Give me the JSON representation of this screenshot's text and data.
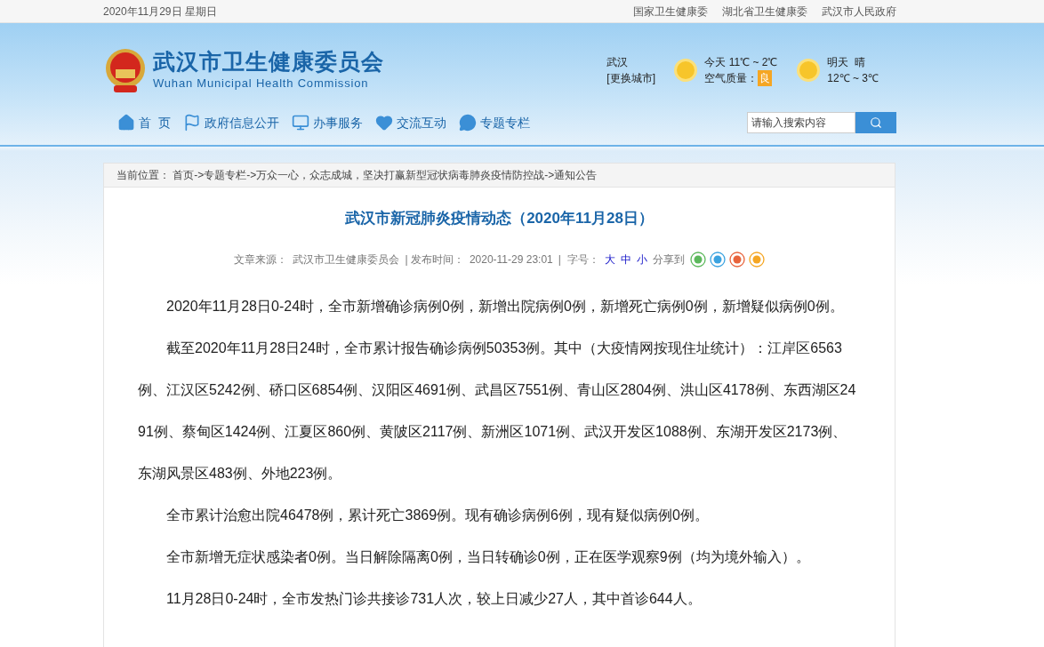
{
  "top_bar": {
    "date": "2020年11月29日 星期日",
    "links": [
      "国家卫生健康委",
      "湖北省卫生健康委",
      "武汉市人民政府"
    ]
  },
  "header": {
    "title": "武汉市卫生健康委员会",
    "subtitle": "Wuhan Municipal Health Commission",
    "weather": {
      "city": "武汉",
      "change_city": "[更换城市]",
      "today": "今天 11℃ ~ 2℃",
      "air_label": "空气质量：",
      "air_value": "良",
      "tomorrow": "明天  晴",
      "tomorrow_temp": "12℃ ~ 3℃"
    }
  },
  "nav": [
    {
      "kind": "home",
      "label": "首  页"
    },
    {
      "kind": "flag",
      "label": "政府信息公开"
    },
    {
      "kind": "monitor",
      "label": "办事服务"
    },
    {
      "kind": "heart",
      "label": "交流互动"
    },
    {
      "kind": "chat",
      "label": "专题专栏"
    }
  ],
  "search": {
    "placeholder": "请输入搜索内容"
  },
  "breadcrumb": "当前位置： 首页->专题专栏->万众一心，众志成城，坚决打赢新型冠状病毒肺炎疫情防控战->通知公告",
  "article": {
    "title": "武汉市新冠肺炎疫情动态（2020年11月28日）",
    "meta": {
      "source_label": "文章来源：",
      "source": "武汉市卫生健康委员会",
      "time_label": "| 发布时间：",
      "time": "2020-11-29 23:01",
      "size_label": "|  字号：",
      "sizes": [
        "大",
        "中",
        "小"
      ],
      "share_label": "分享到"
    },
    "paragraphs": [
      "2020年11月28日0-24时，全市新增确诊病例0例，新增出院病例0例，新增死亡病例0例，新增疑似病例0例。",
      "截至2020年11月28日24时，全市累计报告确诊病例50353例。其中（大疫情网按现住址统计）：江岸区6563例、江汉区5242例、硚口区6854例、汉阳区4691例、武昌区7551例、青山区2804例、洪山区4178例、东西湖区2491例、蔡甸区1424例、江夏区860例、黄陂区2117例、新洲区1071例、武汉开发区1088例、东湖开发区2173例、东湖风景区483例、外地223例。",
      "全市累计治愈出院46478例，累计死亡3869例。现有确诊病例6例，现有疑似病例0例。",
      "全市新增无症状感染者0例。当日解除隔离0例，当日转确诊0例，正在医学观察9例（均为境外输入）。",
      "11月28日0-24时，全市发热门诊共接诊731人次，较上日减少27人，其中首诊644人。"
    ]
  }
}
